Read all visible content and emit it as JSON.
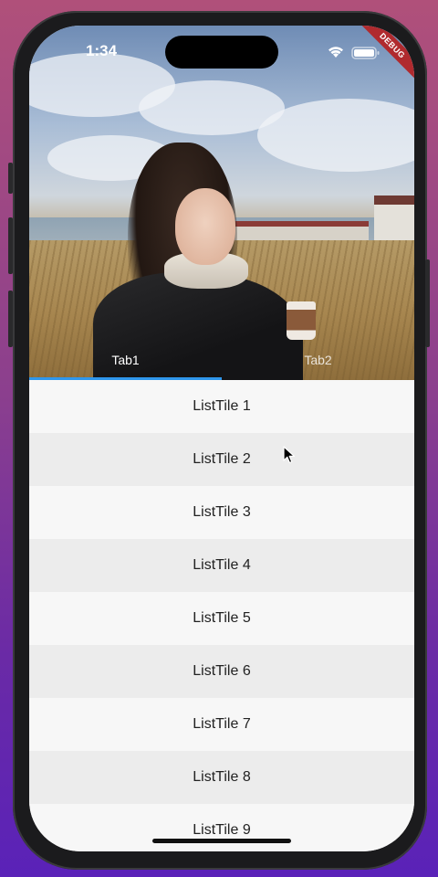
{
  "status_bar": {
    "time": "1:34",
    "debug_label": "DEBUG",
    "wifi_icon": "wifi-icon",
    "battery_icon": "battery-icon"
  },
  "header": {
    "image": "header-photo"
  },
  "tabs": [
    {
      "label": "Tab1",
      "selected": true
    },
    {
      "label": "Tab2",
      "selected": false
    }
  ],
  "indicator_color": "#2f97ec",
  "list": {
    "items": [
      "ListTile 1",
      "ListTile 2",
      "ListTile 3",
      "ListTile 4",
      "ListTile 5",
      "ListTile 6",
      "ListTile 7",
      "ListTile 8",
      "ListTile 9"
    ]
  }
}
